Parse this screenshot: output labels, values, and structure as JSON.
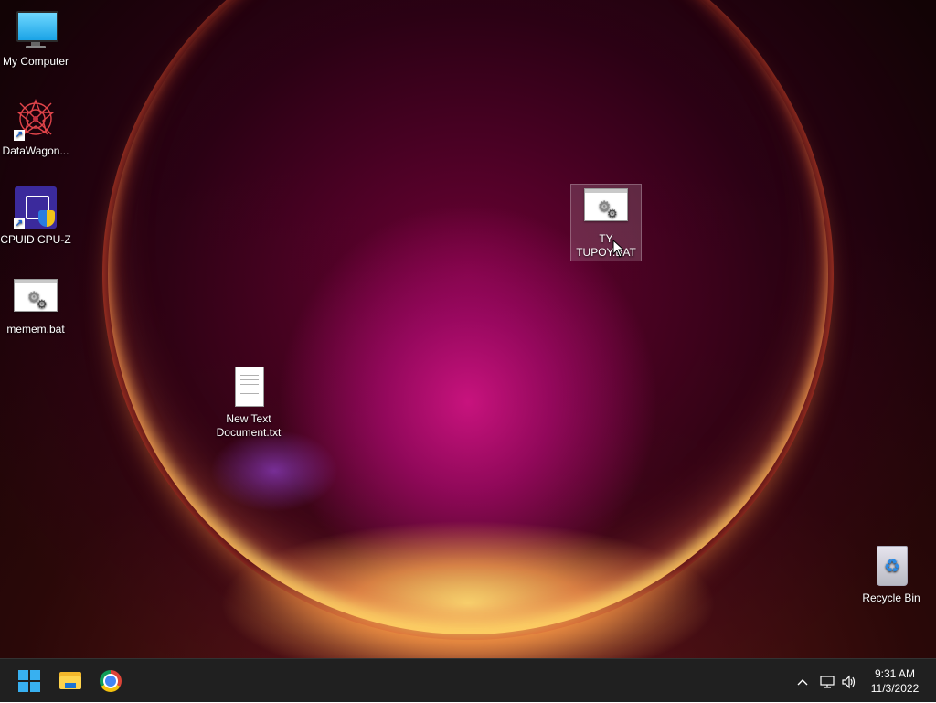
{
  "desktop": {
    "icons": [
      {
        "label": "My Computer",
        "icon": "monitor-icon"
      },
      {
        "label": "DataWagon...",
        "icon": "datawagon-icon"
      },
      {
        "label": "CPUID CPU-Z",
        "icon": "cpuz-icon"
      },
      {
        "label": "memem.bat",
        "icon": "bat-file-icon"
      },
      {
        "label": "New Text\nDocument.txt",
        "icon": "text-document-icon"
      },
      {
        "label": "TY\nTUPOY.BAT",
        "icon": "bat-file-icon"
      },
      {
        "label": "Recycle Bin",
        "icon": "recycle-bin-icon"
      }
    ]
  },
  "taskbar": {
    "pinned": [
      "start-windows-icon",
      "file-explorer-icon",
      "chrome-icon"
    ],
    "tray": {
      "chevron": "^",
      "network_icon": "network-icon",
      "volume_icon": "volume-icon"
    },
    "clock": {
      "time": "9:31 AM",
      "date": "11/3/2022"
    }
  },
  "colors": {
    "taskbar_bg": "#202020",
    "windows_blue": "#38b0f0"
  }
}
